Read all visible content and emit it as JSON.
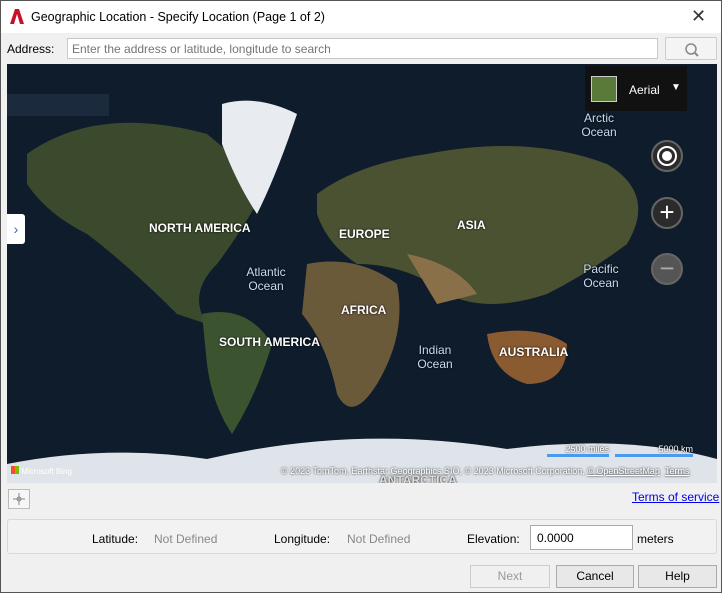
{
  "window": {
    "title": "Geographic Location - Specify Location (Page 1 of 2)",
    "close": "✕",
    "app_icon": "autocad-logo",
    "accent": "#c8102e"
  },
  "address": {
    "label": "Address:",
    "placeholder": "Enter the address or latitude, longitude to search",
    "search_icon": "search-icon"
  },
  "map": {
    "style_label": "Aerial",
    "continents": [
      "NORTH AMERICA",
      "EUROPE",
      "ASIA",
      "AFRICA",
      "SOUTH AMERICA",
      "AUSTRALIA",
      "ANTARCTICA"
    ],
    "oceans": [
      "Arctic Ocean",
      "Atlantic Ocean",
      "Pacific Ocean",
      "Indian Ocean"
    ],
    "scale_miles": "2500 miles",
    "scale_km": "5000 km",
    "attribution": "© 2023 TomTom, Earthstar Geographics SIO, © 2023 Microsoft Corporation,",
    "osm": "© OpenStreetMap",
    "terms": "Terms",
    "logo": "Microsoft Bing"
  },
  "terms_link": "Terms of service",
  "coords": {
    "lat_label": "Latitude:",
    "lat_value": "Not Defined",
    "lon_label": "Longitude:",
    "lon_value": "Not Defined",
    "elev_label": "Elevation:",
    "elev_value": "0.0000",
    "elev_unit": "meters"
  },
  "buttons": {
    "next": "Next",
    "cancel": "Cancel",
    "help": "Help"
  }
}
